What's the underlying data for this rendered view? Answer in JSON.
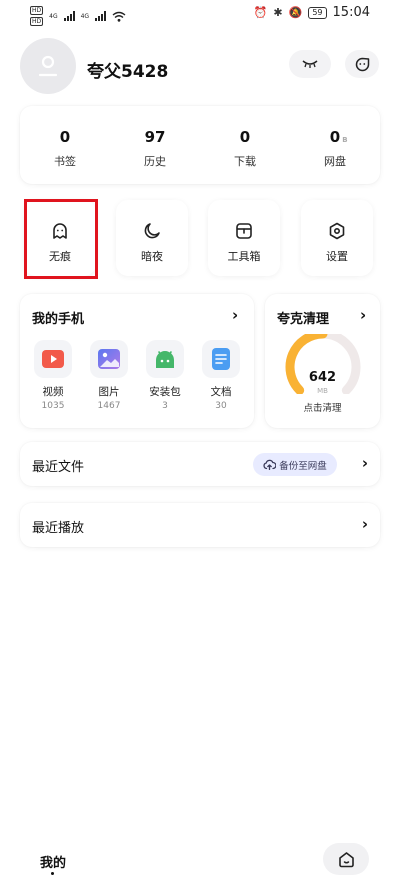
{
  "statusbar": {
    "sim1": "HD",
    "sim2": "HD",
    "net1": "4G",
    "net2": "4G",
    "battery": "59",
    "time": "15:04"
  },
  "profile": {
    "username": "夸父5428",
    "icons": [
      "avatar-person-icon",
      "eye-closed-icon",
      "chat-face-icon"
    ]
  },
  "stats": [
    {
      "value": "0",
      "label": "书签"
    },
    {
      "value": "97",
      "label": "历史"
    },
    {
      "value": "0",
      "label": "下载"
    },
    {
      "value": "0",
      "unit": "B",
      "label": "网盘"
    }
  ],
  "tiles": [
    {
      "label": "无痕",
      "icon": "ghost-icon"
    },
    {
      "label": "暗夜",
      "icon": "moon-icon"
    },
    {
      "label": "工具箱",
      "icon": "toolbox-icon"
    },
    {
      "label": "设置",
      "icon": "settings-hexagon-icon"
    }
  ],
  "my_phone": {
    "title": "我的手机",
    "arrow": "›",
    "apps": [
      {
        "label": "视频",
        "count": "1035",
        "icon": "video-icon",
        "color": "#f25a4a"
      },
      {
        "label": "图片",
        "count": "1467",
        "icon": "image-icon",
        "color": "#6b7cf5"
      },
      {
        "label": "安装包",
        "count": "3",
        "icon": "android-icon",
        "color": "#45b76a"
      },
      {
        "label": "文档",
        "count": "30",
        "icon": "document-icon",
        "color": "#4b9df2"
      }
    ]
  },
  "cleanup": {
    "title": "夸克清理",
    "arrow": "›",
    "value": "642",
    "unit": "MB",
    "action": "点击清理",
    "gauge_fraction": 0.5,
    "gauge_color": "#f9b234",
    "track_color": "#efe9e9"
  },
  "recent_files": {
    "label": "最近文件",
    "backup_label": "备份至网盘",
    "arrow": "›"
  },
  "recent_play": {
    "label": "最近播放",
    "arrow": "›"
  },
  "bottom": {
    "title": "我的"
  },
  "colors": {
    "highlight": "#e0141e",
    "backup_bg": "#e8ebff"
  }
}
